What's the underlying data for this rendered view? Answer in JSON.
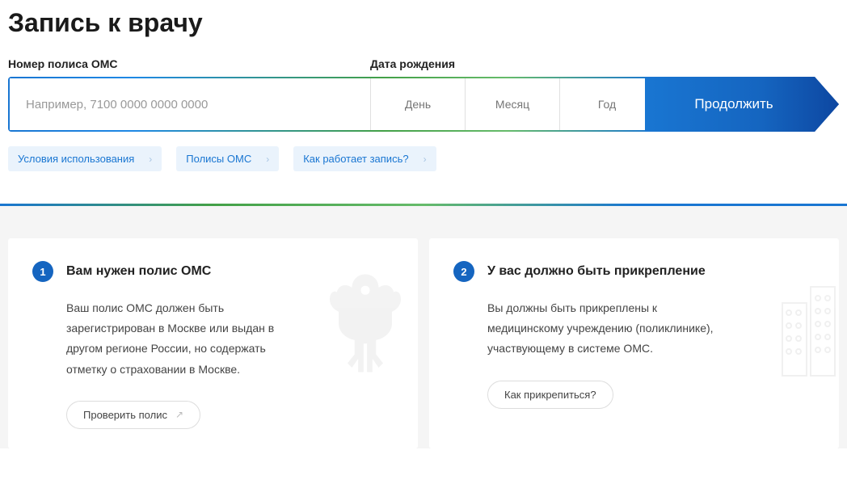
{
  "page_title": "Запись к врачу",
  "form": {
    "policy_label": "Номер полиса ОМС",
    "policy_placeholder": "Например, 7100 0000 0000 0000",
    "dob_label": "Дата рождения",
    "day_placeholder": "День",
    "month_placeholder": "Месяц",
    "year_placeholder": "Год",
    "continue_label": "Продолжить"
  },
  "links": {
    "terms": "Условия использования",
    "policies": "Полисы ОМС",
    "how_it_works": "Как работает запись?"
  },
  "steps": {
    "step1": {
      "number": "1",
      "title": "Вам нужен полис ОМС",
      "text": "Ваш полис ОМС должен быть зарегистрирован в Москве или выдан в другом регионе России, но содержать отметку о страховании в Москве.",
      "button": "Проверить полис"
    },
    "step2": {
      "number": "2",
      "title": "У вас должно быть прикрепление",
      "text": "Вы должны быть прикреплены к медицинскому учреждению (поликлинике), участвующему в системе ОМС.",
      "button": "Как прикрепиться?"
    }
  }
}
